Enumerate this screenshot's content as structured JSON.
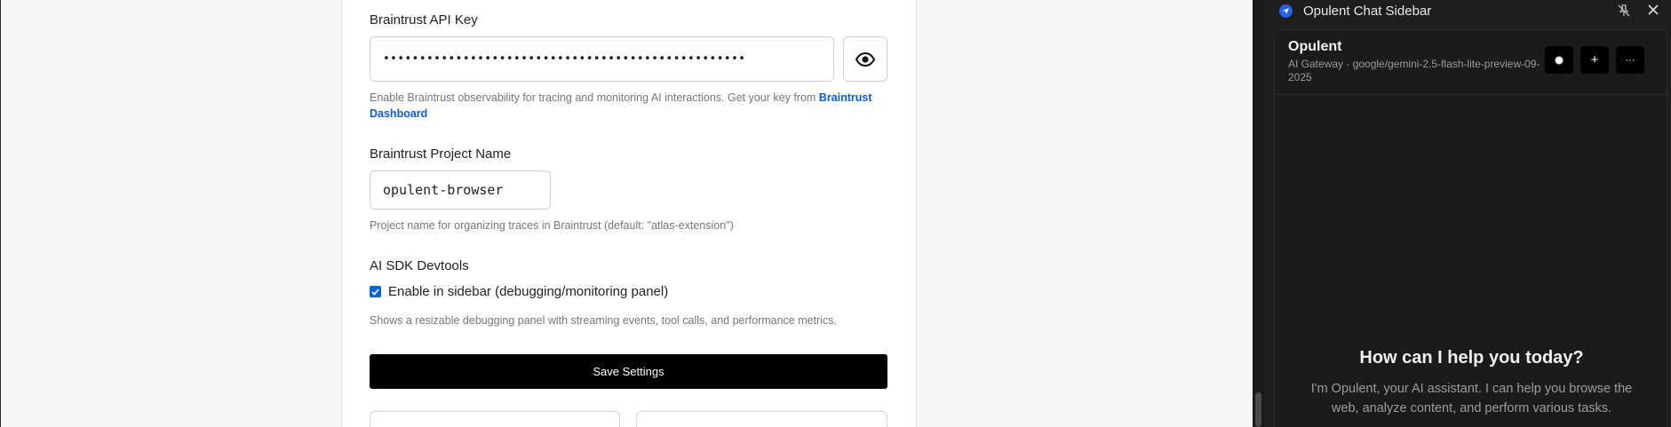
{
  "settings": {
    "api_key_label": "Braintrust API Key",
    "api_key_value": "••••••••••••••••••••••••••••••••••••••••••••••••••",
    "api_key_help_prefix": "Enable Braintrust observability for tracing and monitoring AI interactions. Get your key from ",
    "api_key_help_link": "Braintrust Dashboard",
    "project_label": "Braintrust Project Name",
    "project_value": "opulent-browser",
    "project_help": "Project name for organizing traces in Braintrust (default: \"atlas-extension\")",
    "devtools_label": "AI SDK Devtools",
    "devtools_checkbox_label": "Enable in sidebar (debugging/monitoring panel)",
    "devtools_checked": true,
    "devtools_help": "Shows a resizable debugging panel with streaming events, tool calls, and performance metrics.",
    "save_label": "Save Settings"
  },
  "sidebar": {
    "title": "Opulent Chat Sidebar",
    "header_title": "Opulent",
    "header_subtitle": "AI Gateway · google/gemini-2.5-flash-lite-preview-09-2025",
    "new_chat_symbol": "+",
    "more_symbol": "···",
    "welcome_title": "How can I help you today?",
    "welcome_text": "I'm Opulent, your AI assistant. I can help you browse the web, analyze content, and perform various tasks."
  },
  "colors": {
    "accent": "#0b62d6",
    "link": "#0b5cd5",
    "sidebar_bg": "#1e1e1e"
  }
}
